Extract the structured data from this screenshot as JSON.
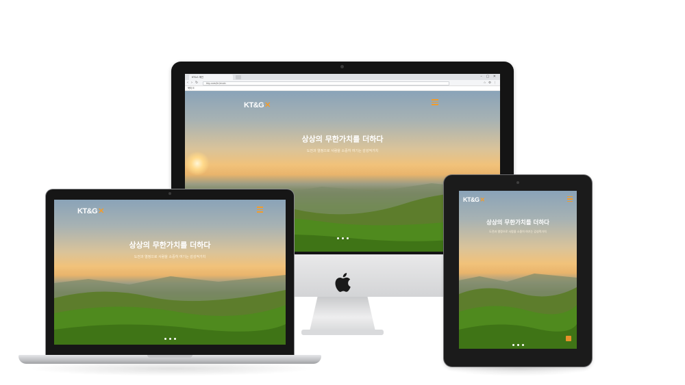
{
  "brand": {
    "logo_text": "KT&G",
    "logo_mark": "✕",
    "accent_color": "#f39c2a"
  },
  "hero": {
    "title": "상상의 무한가치를 더하다",
    "subtitle": "도전과 열정으로 사람을 소중히 여기는 감성적가치"
  },
  "browser": {
    "tab_label": "KT&G 메인",
    "url": "ktg.com/kr/main",
    "bookmark_label": "북마크",
    "back_icon": "arrow-left-icon",
    "forward_icon": "arrow-right-icon",
    "reload_icon": "reload-icon",
    "window_buttons": "–  ▢  ✕",
    "extension_icons": "☆ ⚙ ⋮"
  },
  "devices": {
    "desktop": "imac",
    "laptop": "macbook",
    "tablet": "ipad"
  },
  "carousel": {
    "dots": 3,
    "active": 0
  },
  "icons": {
    "menu": "hamburger-menu-icon",
    "apple": "apple-logo-icon"
  }
}
